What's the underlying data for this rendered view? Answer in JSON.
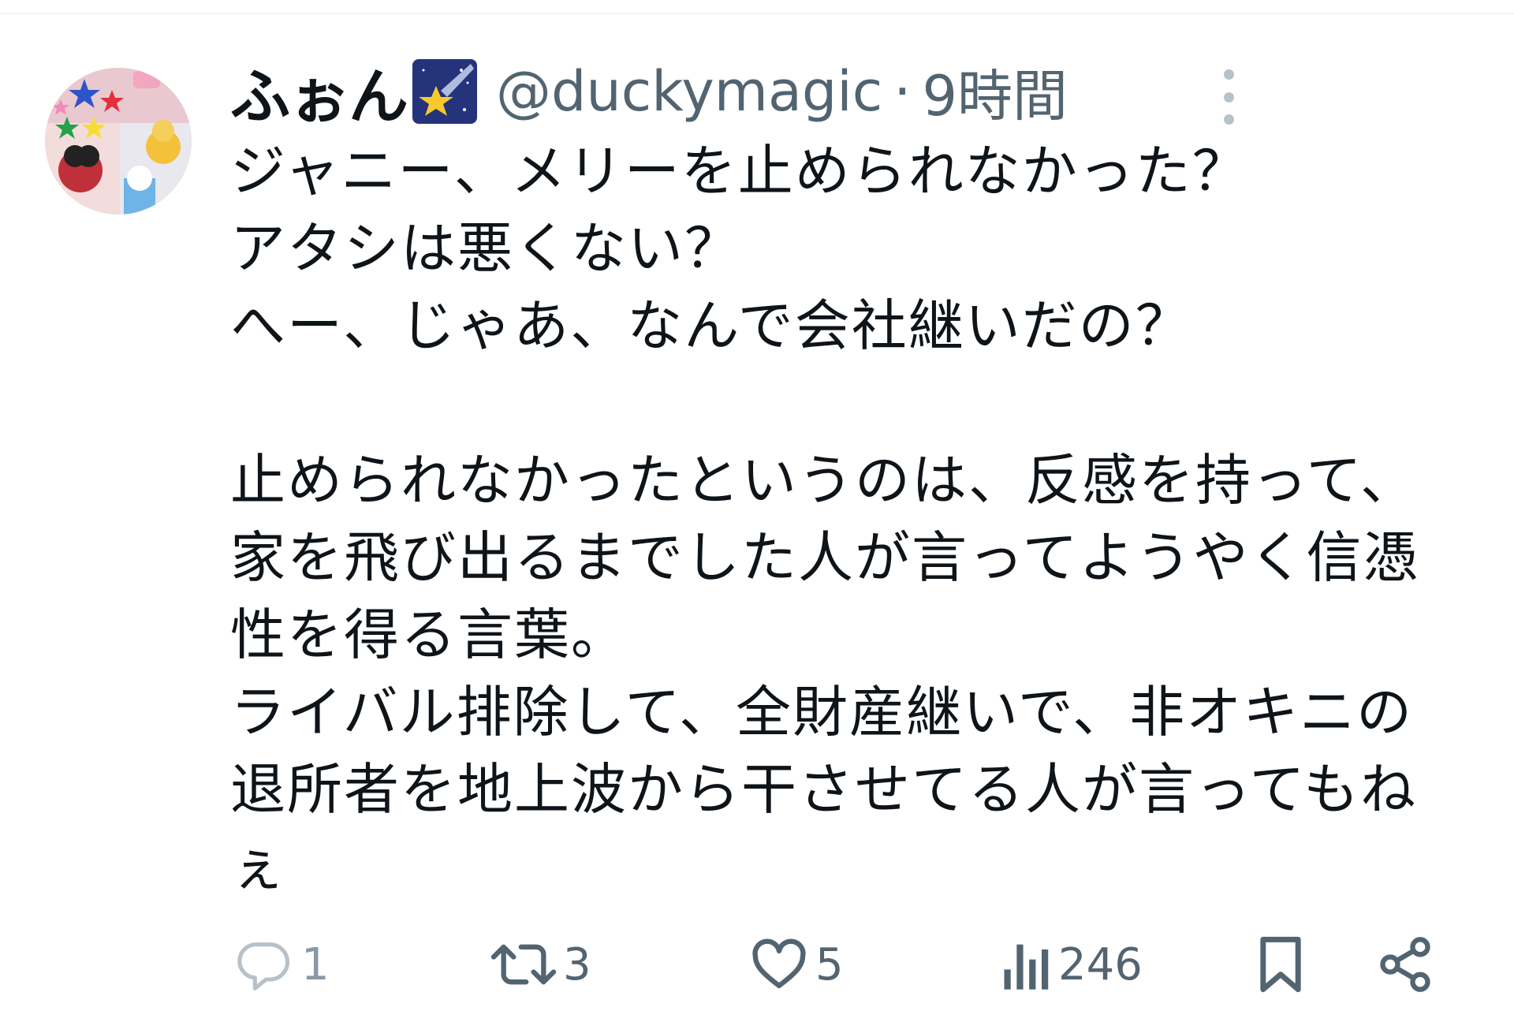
{
  "tweet": {
    "author": {
      "display_name": "ふぉん",
      "badge_icon": "shooting-star-emoji",
      "handle": "@duckymagic",
      "separator": "·",
      "time": "9時間"
    },
    "text": "ジャニー、メリーを止められなかった？\nアタシは悪くない？\nへー、じゃあ、なんで会社継いだの？\n\n止められなかったというのは、反感を持って、\n家を飛び出るまでした人が言ってようやく信憑\n性を得る言葉。\nライバル排除して、全財産継いで、非オキニの\n退所者を地上波から干させてる人が言ってもね\nぇ",
    "actions": {
      "reply": {
        "icon": "reply-icon",
        "count": "1"
      },
      "retweet": {
        "icon": "retweet-icon",
        "count": "3"
      },
      "like": {
        "icon": "heart-icon",
        "count": "5"
      },
      "views": {
        "icon": "views-icon",
        "count": "246"
      },
      "bookmark": {
        "icon": "bookmark-icon"
      },
      "share": {
        "icon": "share-icon"
      }
    },
    "more_icon": "more-vertical-icon"
  },
  "colors": {
    "text_primary": "#0f1419",
    "text_secondary": "#536471",
    "divider": "#eff3f4"
  }
}
